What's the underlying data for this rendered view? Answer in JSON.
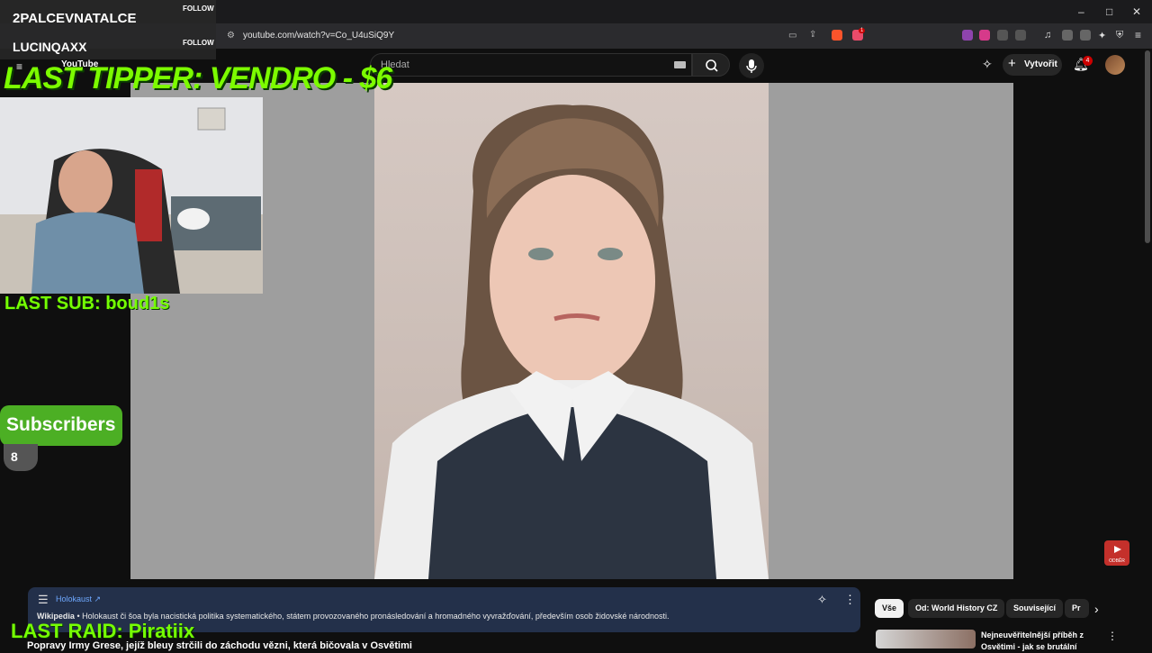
{
  "browser": {
    "url": "youtube.com/watch?v=Co_U4uSiQ9Y",
    "window_controls": [
      "–",
      "□",
      "✕"
    ],
    "extension_badge_count": "1"
  },
  "youtube": {
    "logo": "YouTube",
    "search_placeholder": "Hledat",
    "create_label": "Vytvořit",
    "notifications_count": "4",
    "subscribe_badge_label": "ODBĚR"
  },
  "info_panel": {
    "title": "Holokaust ↗",
    "source": "Wikipedia",
    "text": " • Holokaust či šoa byla nacistická politika systematického, státem provozovaného pronásledování a hromadného vyvražďování, především osob židovské národnosti."
  },
  "video_title": "Popravy Irmy Grese, jejíž bleuy strčili do záchodu vězni, která bičovala v Osvětimi",
  "chips": [
    "Vše",
    "Od: World History CZ",
    "Související",
    "Pr"
  ],
  "recommendation": {
    "title": "Nejneuvěřitelnější příběh z Osvětimi - jak se brutální"
  },
  "overlays": {
    "followers": [
      {
        "name": "2PALCEVNATALCE",
        "label": "FOLLOW"
      },
      {
        "name": "LUCINQAXX",
        "label": "FOLLOW"
      }
    ],
    "last_tipper": "LAST TIPPER: VENDRO - $6",
    "last_sub": "LAST SUB: boud1s",
    "subscribers_label": "Subscribers",
    "subscribers_count": "8",
    "last_raid": "LAST RAID: Piratiix"
  },
  "colors": {
    "overlay_green": "#76ff03",
    "info_panel": "#23304a",
    "youtube_red": "#c4302b"
  }
}
